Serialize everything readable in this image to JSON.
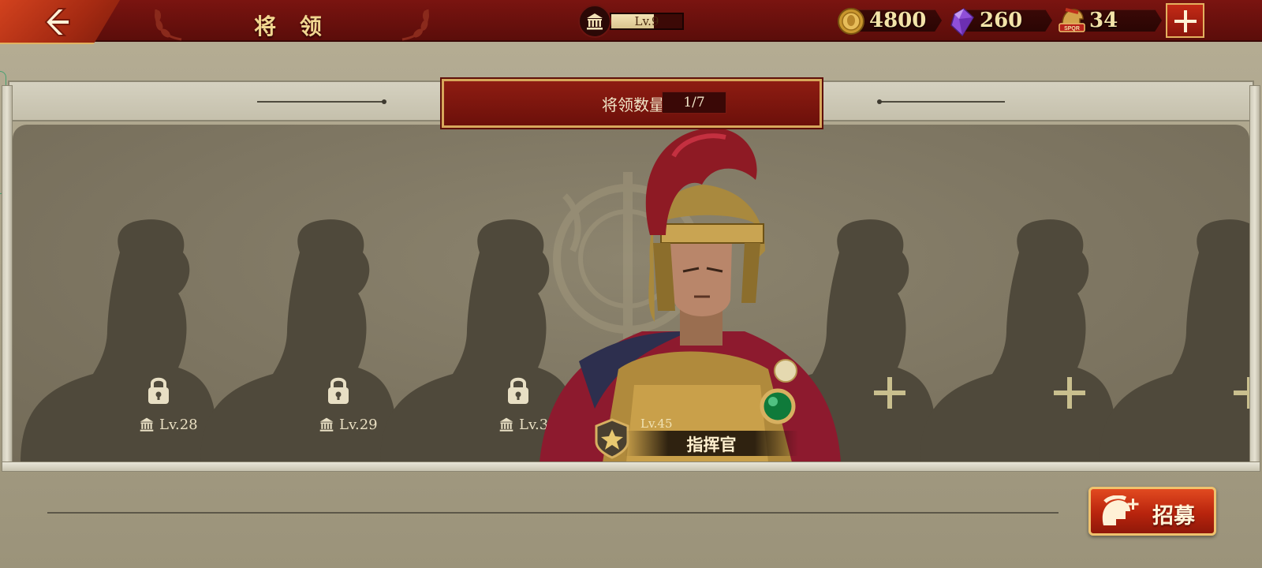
{
  "header": {
    "title": "将 领",
    "level_label": "Lv.9",
    "level_progress": 0.6,
    "back_icon": "back-arrow-icon"
  },
  "currencies": [
    {
      "name": "gold",
      "icon": "gold-coin-icon",
      "value": "4800"
    },
    {
      "name": "gem",
      "icon": "purple-gem-icon",
      "value": "260"
    },
    {
      "name": "spqr",
      "icon": "spqr-helmet-icon",
      "value": "34"
    }
  ],
  "add_button_icon": "plus-icon",
  "general_count": {
    "label": "将领数量",
    "value": "1/7"
  },
  "slots": [
    {
      "state": "locked",
      "level": "Lv.28"
    },
    {
      "state": "locked",
      "level": "Lv.29"
    },
    {
      "state": "locked",
      "level": "Lv.30"
    },
    {
      "state": "empty"
    },
    {
      "state": "empty"
    },
    {
      "state": "empty"
    }
  ],
  "commander": {
    "level": "Lv.45",
    "name": "指挥官",
    "rank_icon": "star-shield-icon"
  },
  "recruit": {
    "label": "招募",
    "icon": "recruit-helmet-icon"
  },
  "colors": {
    "header_red": "#6a100c",
    "gold_text": "#f3e3a8",
    "button_red": "#c8300f",
    "button_border": "#f0c26d",
    "arena": "#80786a"
  }
}
